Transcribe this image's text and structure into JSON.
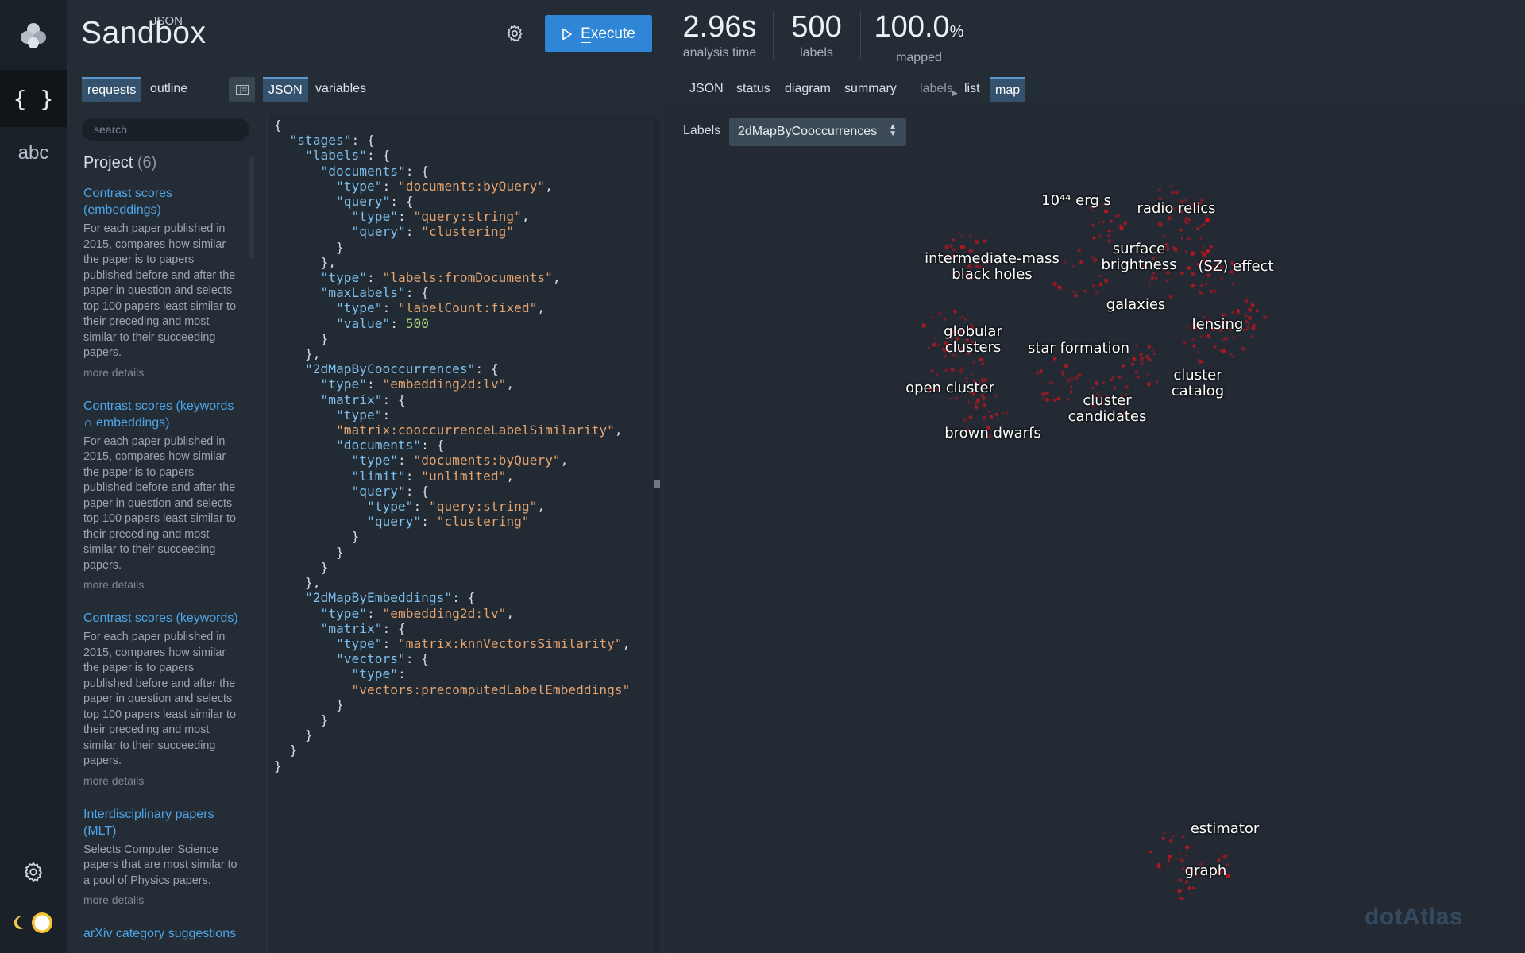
{
  "app": {
    "brand_small": "JSON",
    "brand_big": "Sandbox",
    "execute_label": "Execute",
    "execute_label_rest": "xecute"
  },
  "stats": [
    {
      "value": "2.96s",
      "unit": "",
      "label": "analysis time"
    },
    {
      "value": "500",
      "unit": "",
      "label": "labels"
    },
    {
      "value": "100.0",
      "unit": "%",
      "label": "mapped"
    }
  ],
  "rail": {
    "json_icon": "{ }",
    "abc_label": "abc",
    "icons": [
      "dotatlas-logo-icon",
      "json-braces-icon",
      "abc-icon",
      "gear-icon",
      "moon-icon",
      "theme-toggle-icon"
    ]
  },
  "left_tabs": {
    "requests": "requests",
    "outline": "outline"
  },
  "editor_tabs": {
    "json": "JSON",
    "variables": "variables"
  },
  "right_tabs": {
    "json": "JSON",
    "status": "status",
    "diagram": "diagram",
    "summary": "summary",
    "labels": "labels",
    "list": "list",
    "map": "map"
  },
  "search": {
    "placeholder": "search"
  },
  "project": {
    "title": "Project",
    "count": "(6)"
  },
  "requests": [
    {
      "title": "Contrast scores (embeddings)",
      "description": "For each paper published in 2015, compares how similar the paper is to papers published before and after the paper in question and selects top 100 papers least similar to their preceding and most similar to their succeeding papers.",
      "more": "more details"
    },
    {
      "title": "Contrast scores (keywords ∩ embeddings)",
      "description": "For each paper published in 2015, compares how similar the paper is to papers published before and after the paper in question and selects top 100 papers least similar to their preceding and most similar to their succeeding papers.",
      "more": "more details"
    },
    {
      "title": "Contrast scores (keywords)",
      "description": "For each paper published in 2015, compares how similar the paper is to papers published before and after the paper in question and selects top 100 papers least similar to their preceding and most similar to their succeeding papers.",
      "more": "more details"
    },
    {
      "title": "Interdisciplinary papers (MLT)",
      "description": "Selects Computer Science papers that are most similar to a pool of Physics papers.",
      "more": "more details"
    },
    {
      "title": "arXiv category suggestions",
      "description": "",
      "more": ""
    }
  ],
  "editor": {
    "lines": [
      "{",
      "  \"stages\": {",
      "    \"labels\": {",
      "      \"documents\": {",
      "        \"type\": \"documents:byQuery\",",
      "        \"query\": {",
      "          \"type\": \"query:string\",",
      "          \"query\": \"clustering\"",
      "        }",
      "      },",
      "      \"type\": \"labels:fromDocuments\",",
      "      \"maxLabels\": {",
      "        \"type\": \"labelCount:fixed\",",
      "        \"value\": 500",
      "      }",
      "    },",
      "    \"2dMapByCooccurrences\": {",
      "      \"type\": \"embedding2d:lv\",",
      "      \"matrix\": {",
      "        \"type\":",
      "        \"matrix:cooccurrenceLabelSimilarity\",",
      "        \"documents\": {",
      "          \"type\": \"documents:byQuery\",",
      "          \"limit\": \"unlimited\",",
      "          \"query\": {",
      "            \"type\": \"query:string\",",
      "            \"query\": \"clustering\"",
      "          }",
      "        }",
      "      }",
      "    },",
      "    \"2dMapByEmbeddings\": {",
      "      \"type\": \"embedding2d:lv\",",
      "      \"matrix\": {",
      "        \"type\": \"matrix:knnVectorsSimilarity\",",
      "        \"vectors\": {",
      "          \"type\":",
      "          \"vectors:precomputedLabelEmbeddings\"",
      "        }",
      "      }",
      "    }",
      "  }",
      "}"
    ]
  },
  "map_panel": {
    "labels_caption": "Labels",
    "selected_map": "2dMapByCooccurrences",
    "labels": [
      {
        "text": "10⁴⁴ erg s"
      },
      {
        "text": "radio relics"
      },
      {
        "text": "intermediate-mass\nblack holes"
      },
      {
        "text": "surface\nbrightness"
      },
      {
        "text": "(SZ) effect"
      },
      {
        "text": "galaxies"
      },
      {
        "text": "lensing"
      },
      {
        "text": "globular\nclusters"
      },
      {
        "text": "star formation"
      },
      {
        "text": "open cluster"
      },
      {
        "text": "cluster\ncatalog"
      },
      {
        "text": "cluster\ncandidates"
      },
      {
        "text": "brown dwarfs"
      },
      {
        "text": "estimator"
      },
      {
        "text": "graph"
      }
    ],
    "point_color": "#c8141e"
  },
  "watermark": "dotAtlas",
  "colors": {
    "accent": "#2f86d6",
    "link": "#4ea6e8",
    "tab_active": "#34516d"
  }
}
